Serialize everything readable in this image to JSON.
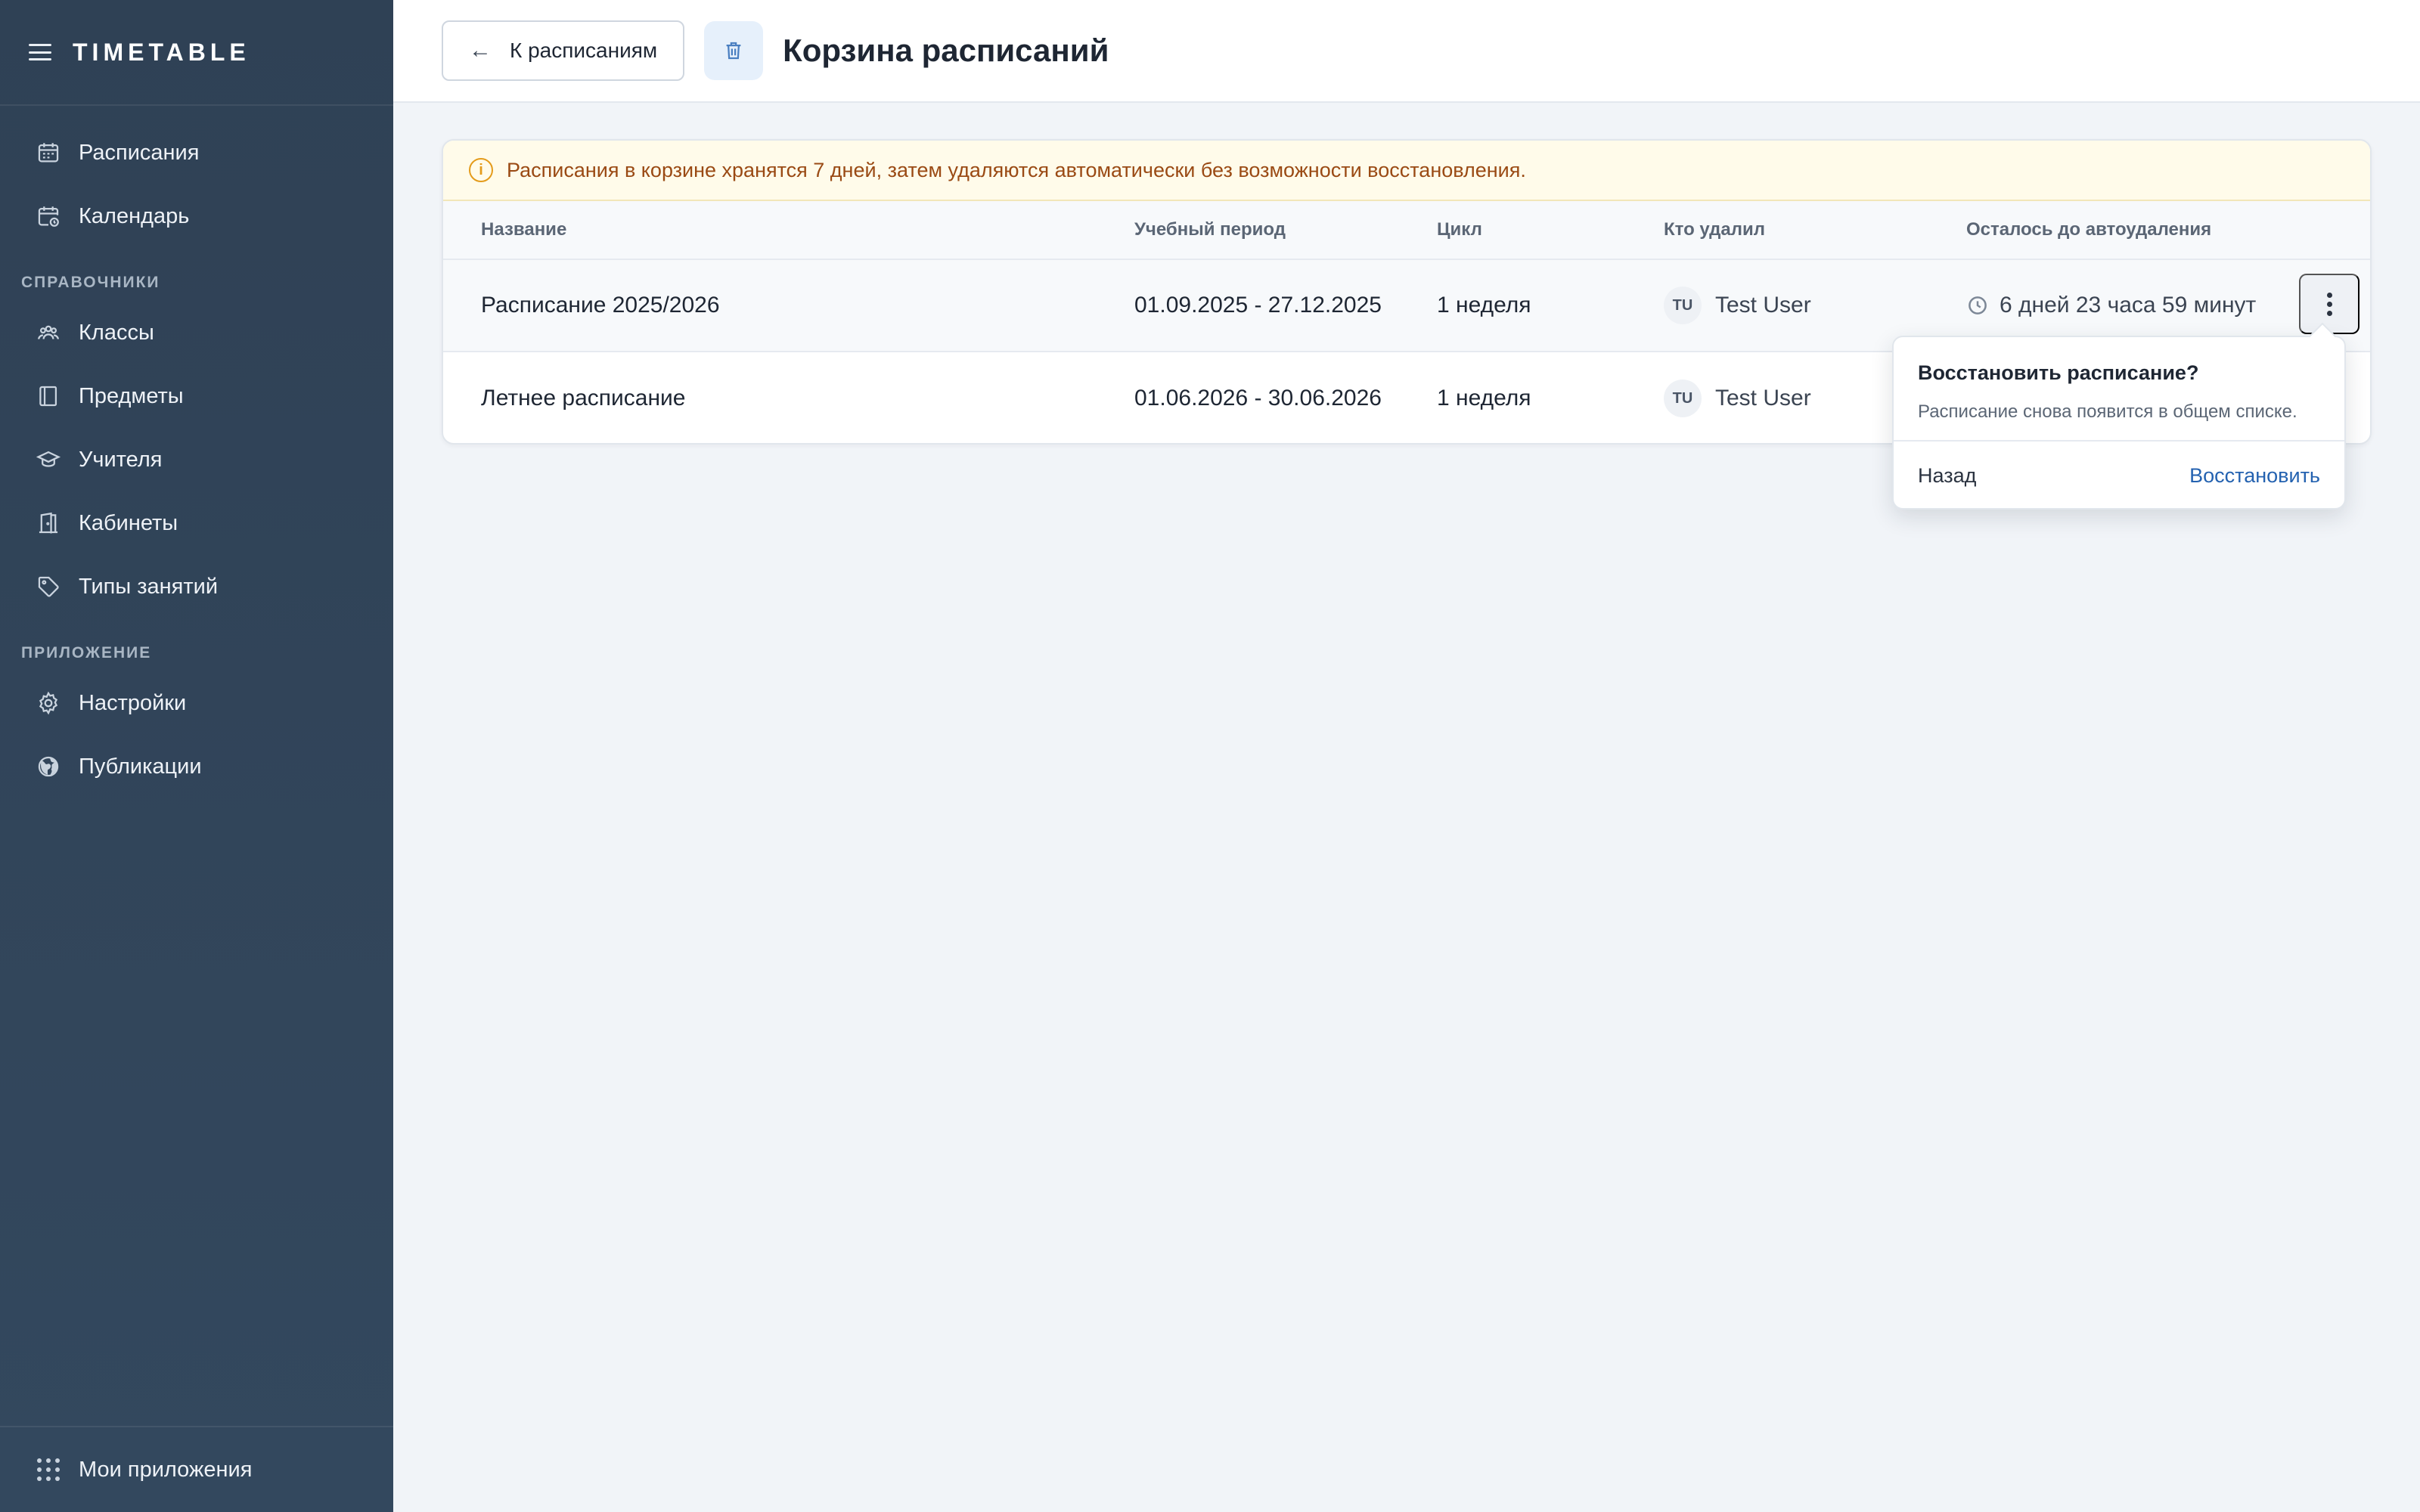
{
  "app": {
    "brand": "TIMETABLE"
  },
  "sidebar": {
    "items": [
      {
        "label": "Расписания",
        "icon": "calendar-icon"
      },
      {
        "label": "Календарь",
        "icon": "calendar-clock-icon"
      }
    ],
    "section_refs": "СПРАВОЧНИКИ",
    "ref_items": [
      {
        "label": "Классы",
        "icon": "users-icon"
      },
      {
        "label": "Предметы",
        "icon": "book-icon"
      },
      {
        "label": "Учителя",
        "icon": "graduation-cap-icon"
      },
      {
        "label": "Кабинеты",
        "icon": "door-icon"
      },
      {
        "label": "Типы занятий",
        "icon": "tag-icon"
      }
    ],
    "section_app": "ПРИЛОЖЕНИЕ",
    "app_items": [
      {
        "label": "Настройки",
        "icon": "gear-icon"
      },
      {
        "label": "Публикации",
        "icon": "globe-icon"
      }
    ],
    "footer": {
      "label": "Мои приложения",
      "icon": "grid-icon"
    }
  },
  "header": {
    "back_label": "К расписаниям",
    "title": "Корзина расписаний"
  },
  "notice": {
    "text": "Расписания в корзине хранятся 7 дней, затем удаляются автоматически без возможности восстановления."
  },
  "table": {
    "columns": {
      "name": "Название",
      "period": "Учебный период",
      "cycle": "Цикл",
      "deleted_by": "Кто удалил",
      "time_left": "Осталось до автоудаления"
    },
    "rows": [
      {
        "name": "Расписание 2025/2026",
        "period": "01.09.2025 - 27.12.2025",
        "cycle": "1 неделя",
        "user_initials": "TU",
        "user": "Test User",
        "time_left": "6 дней 23 часа 59 минут"
      },
      {
        "name": "Летнее расписание",
        "period": "01.06.2026 - 30.06.2026",
        "cycle": "1 неделя",
        "user_initials": "TU",
        "user": "Test User"
      }
    ]
  },
  "popover": {
    "title": "Восстановить расписание?",
    "text": "Расписание снова появится в общем списке.",
    "cancel": "Назад",
    "confirm": "Восстановить"
  },
  "colors": {
    "sidebar_bg": "#2f4155",
    "accent": "#2462b0",
    "notice_text": "#9a4a14",
    "notice_bg": "#fffbea"
  }
}
